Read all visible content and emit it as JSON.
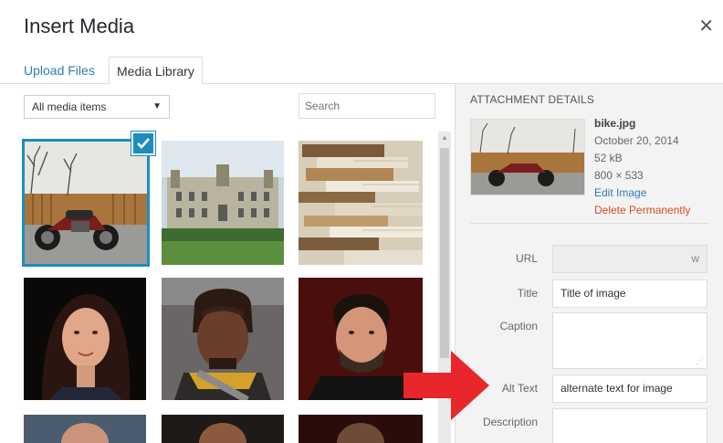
{
  "dialog": {
    "title": "Insert Media",
    "close_icon": "close-icon"
  },
  "tabs": [
    {
      "label": "Upload Files",
      "active": false
    },
    {
      "label": "Media Library",
      "active": true
    }
  ],
  "toolbar": {
    "filter_value": "All media items",
    "search_placeholder": "Search"
  },
  "grid": {
    "items": [
      {
        "name": "bike",
        "selected": true
      },
      {
        "name": "castle",
        "selected": false
      },
      {
        "name": "books",
        "selected": false
      },
      {
        "name": "portrait-woman",
        "selected": false
      },
      {
        "name": "portrait-klingon",
        "selected": false
      },
      {
        "name": "portrait-man-beard",
        "selected": false
      }
    ]
  },
  "details": {
    "heading": "ATTACHMENT DETAILS",
    "filename": "bike.jpg",
    "date": "October 20, 2014",
    "size": "52 kB",
    "dimensions": "800 × 533",
    "edit_link": "Edit Image",
    "delete_link": "Delete Permanently"
  },
  "fields": {
    "url_label": "URL",
    "url_value": "w",
    "title_label": "Title",
    "title_value": "Title of image",
    "caption_label": "Caption",
    "alt_label": "Alt Text",
    "alt_value": "alternate text for image",
    "description_label": "Description"
  },
  "colors": {
    "accent_blue": "#2e7bb8",
    "selection_blue": "#1e8cbe",
    "delete_red": "#d54e21",
    "arrow_red": "#e8262b"
  }
}
